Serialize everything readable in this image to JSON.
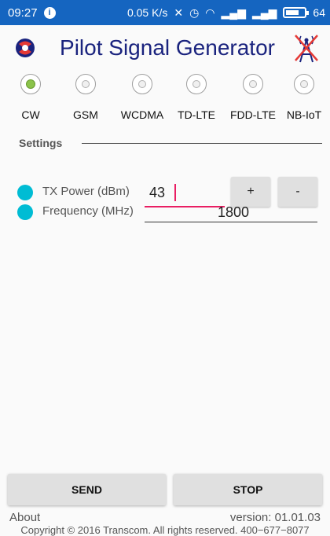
{
  "status_bar": {
    "time": "09:27",
    "speed": "0.05 K/s",
    "battery": "64",
    "background": "#1565c0"
  },
  "header": {
    "title": "Pilot Signal Generator",
    "title_color": "#1a237e"
  },
  "modes": [
    {
      "label": "CW",
      "selected": true
    },
    {
      "label": "GSM",
      "selected": false
    },
    {
      "label": "WCDMA",
      "selected": false
    },
    {
      "label": "TD-LTE",
      "selected": false
    },
    {
      "label": "FDD-LTE",
      "selected": false
    },
    {
      "label": "NB-IoT",
      "selected": false
    }
  ],
  "settings": {
    "title": "Settings",
    "tx_power": {
      "label": "TX Power (dBm)",
      "value": "43",
      "plus": "+",
      "minus": "-"
    },
    "frequency": {
      "label": "Frequency (MHz)",
      "value": "1800"
    },
    "indicator_color": "#00bcd4"
  },
  "actions": {
    "send": "SEND",
    "stop": "STOP"
  },
  "footer": {
    "about": "About",
    "version": "version: 01.01.03",
    "copyright": "Copyright © 2016 Transcom. All rights reserved. 400−677−8077"
  }
}
